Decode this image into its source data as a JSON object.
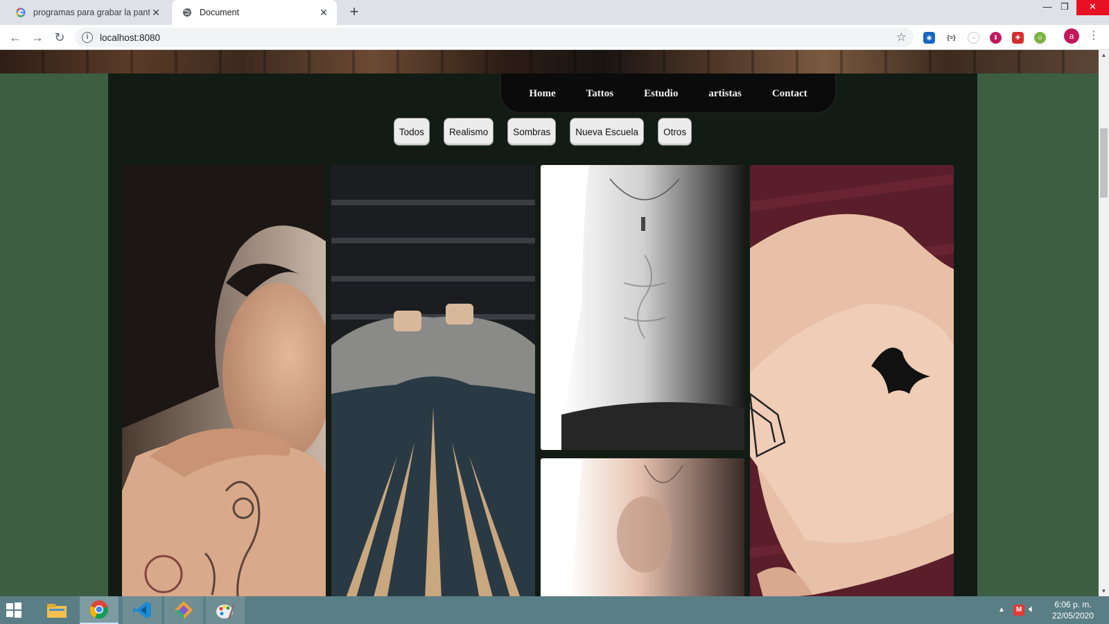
{
  "browser": {
    "tabs": [
      {
        "title": "programas para grabar la pantall",
        "favicon": "google-g-icon",
        "active": false
      },
      {
        "title": "Document",
        "favicon": "globe-icon",
        "active": true
      }
    ],
    "new_tab_label": "+",
    "address": "localhost:8080",
    "profile_initial": "a",
    "extensions": [
      "ext-blue-icon",
      "ext-braces-icon",
      "ext-circle-icon",
      "ext-red-circle-icon",
      "ext-red-square-icon",
      "ext-green-icon"
    ],
    "accent_close": "#e81123"
  },
  "site": {
    "nav": {
      "home": "Home",
      "tattos": "Tattos",
      "estudio": "Estudio",
      "artistas": "artistas",
      "contact": "Contact"
    },
    "filters": {
      "todos": "Todos",
      "realismo": "Realismo",
      "sombras": "Sombras",
      "nueva_escuela": "Nueva Escuela",
      "otros": "Otros"
    },
    "colors": {
      "page_bg": "#3d5e42",
      "container_bg": "#121c15",
      "nav_bg": "#0b0b0b"
    },
    "gallery_items": [
      "woman-shoulder-tattoo-photo",
      "tribal-back-tattoo-photo",
      "bw-torso-photo",
      "hand-bird-tattoo-photo",
      "bw-chest-photo",
      "partial-photo-column-2",
      "partial-photo-column-4"
    ]
  },
  "taskbar": {
    "apps": [
      "windows-start-icon",
      "file-explorer-icon",
      "chrome-icon",
      "vscode-icon",
      "git-app-icon",
      "paint-icon"
    ],
    "time": "6:06 p. m.",
    "date": "22/05/2020"
  }
}
